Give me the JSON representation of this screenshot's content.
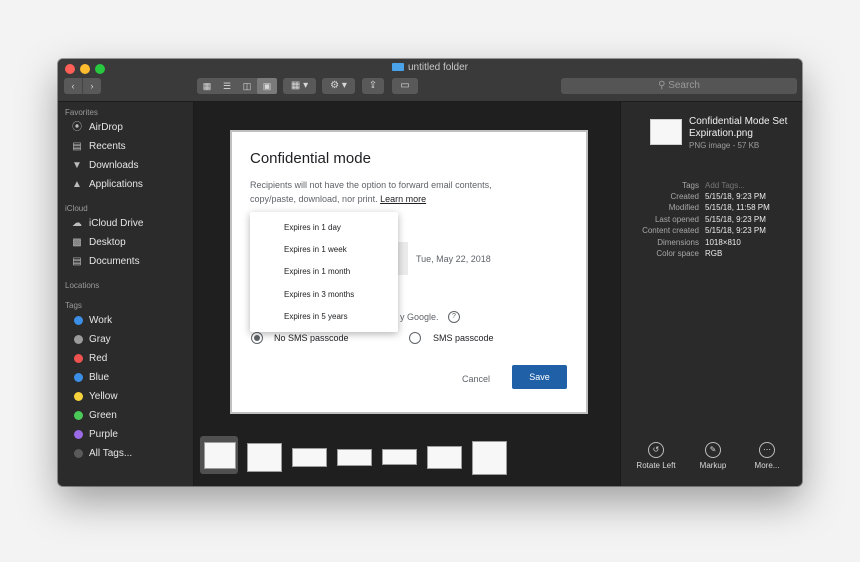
{
  "window": {
    "title": "untitled folder",
    "search_placeholder": "Search"
  },
  "sidebar": {
    "favorites_header": "Favorites",
    "favorites": [
      {
        "label": "AirDrop",
        "icon": "airdrop-icon"
      },
      {
        "label": "Recents",
        "icon": "recents-icon"
      },
      {
        "label": "Downloads",
        "icon": "downloads-icon"
      },
      {
        "label": "Applications",
        "icon": "applications-icon"
      }
    ],
    "icloud_header": "iCloud",
    "icloud": [
      {
        "label": "iCloud Drive",
        "icon": "cloud-icon"
      },
      {
        "label": "Desktop",
        "icon": "desktop-icon"
      },
      {
        "label": "Documents",
        "icon": "documents-icon"
      }
    ],
    "locations_header": "Locations",
    "tags_header": "Tags",
    "tags": [
      {
        "label": "Work",
        "color": "#3b8fe6"
      },
      {
        "label": "Gray",
        "color": "#9b9b9b"
      },
      {
        "label": "Red",
        "color": "#ef5350"
      },
      {
        "label": "Blue",
        "color": "#3b8fe6"
      },
      {
        "label": "Yellow",
        "color": "#f7d23c"
      },
      {
        "label": "Green",
        "color": "#4cca59"
      },
      {
        "label": "Purple",
        "color": "#9b6ae6"
      },
      {
        "label": "All Tags...",
        "color": "#5a5a5a"
      }
    ]
  },
  "dialog": {
    "title": "Confidential mode",
    "description": "Recipients will not have the option to forward email contents, copy/paste, download, nor print.",
    "learn_more": "Learn more",
    "expiry_date": "Tue, May 22, 2018",
    "google_text": "y Google.",
    "radio_no_sms": "No SMS passcode",
    "radio_sms": "SMS passcode",
    "cancel": "Cancel",
    "save": "Save",
    "menu_items": [
      "Expires in 1 day",
      "Expires in 1 week",
      "Expires in 1 month",
      "Expires in 3 months",
      "Expires in 5 years"
    ]
  },
  "preview": {
    "file_name": "Confidential Mode Set Expiration.png",
    "file_sub": "PNG image - 57 KB",
    "meta": [
      {
        "label": "Tags",
        "value": "Add Tags..."
      },
      {
        "label": "Created",
        "value": "5/15/18, 9:23 PM"
      },
      {
        "label": "Modified",
        "value": "5/15/18, 11:58 PM"
      },
      {
        "label": "Last opened",
        "value": "5/15/18, 9:23 PM"
      },
      {
        "label": "Content created",
        "value": "5/15/18, 9:23 PM"
      },
      {
        "label": "Dimensions",
        "value": "1018×810"
      },
      {
        "label": "Color space",
        "value": "RGB"
      }
    ],
    "actions": [
      {
        "label": "Rotate Left",
        "icon": "rotate-left-icon"
      },
      {
        "label": "Markup",
        "icon": "markup-icon"
      },
      {
        "label": "More...",
        "icon": "more-icon"
      }
    ]
  },
  "colors": {
    "save_button": "#1f60a7",
    "close": "#ff5f57",
    "minimize": "#febc2e",
    "zoom": "#28c840"
  }
}
